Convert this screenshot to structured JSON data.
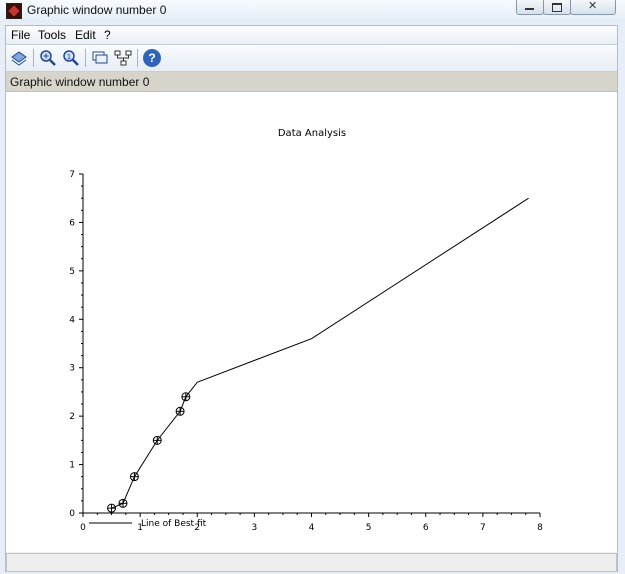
{
  "window": {
    "title": "Graphic window number 0"
  },
  "menu": {
    "items": [
      "File",
      "Tools",
      "Edit",
      "?"
    ]
  },
  "toolbar": {
    "icons": [
      "rotate-icon",
      "zoom-in-icon",
      "zoom-reset-icon",
      "datatip-icon",
      "editor-icon",
      "help-icon"
    ],
    "help_glyph": "?"
  },
  "info": {
    "text": "Graphic window number 0"
  },
  "chart_data": {
    "type": "line",
    "title": "Data Analysis",
    "xlabel": "",
    "ylabel": "",
    "xlim": [
      0,
      8
    ],
    "ylim": [
      0,
      7
    ],
    "xticks": [
      "0",
      "1",
      "2",
      "3",
      "4",
      "5",
      "6",
      "7",
      "8"
    ],
    "yticks": [
      "0",
      "1",
      "2",
      "3",
      "4",
      "5",
      "6",
      "7"
    ],
    "grid": false,
    "legend_position": "bottom-left",
    "series": [
      {
        "name": "Line of Best fit",
        "style": "line",
        "color": "#000000",
        "x": [
          0.5,
          0.7,
          0.9,
          1.3,
          1.7,
          1.8,
          2.0,
          4.0,
          7.8
        ],
        "y": [
          0.1,
          0.2,
          0.75,
          1.5,
          2.1,
          2.4,
          2.7,
          3.6,
          6.5
        ]
      },
      {
        "style": "markers",
        "marker": "circle-plus",
        "color": "#000000",
        "x": [
          0.5,
          0.7,
          0.9,
          1.3,
          1.7,
          1.8
        ],
        "y": [
          0.1,
          0.2,
          0.75,
          1.5,
          2.1,
          2.4
        ]
      }
    ]
  }
}
